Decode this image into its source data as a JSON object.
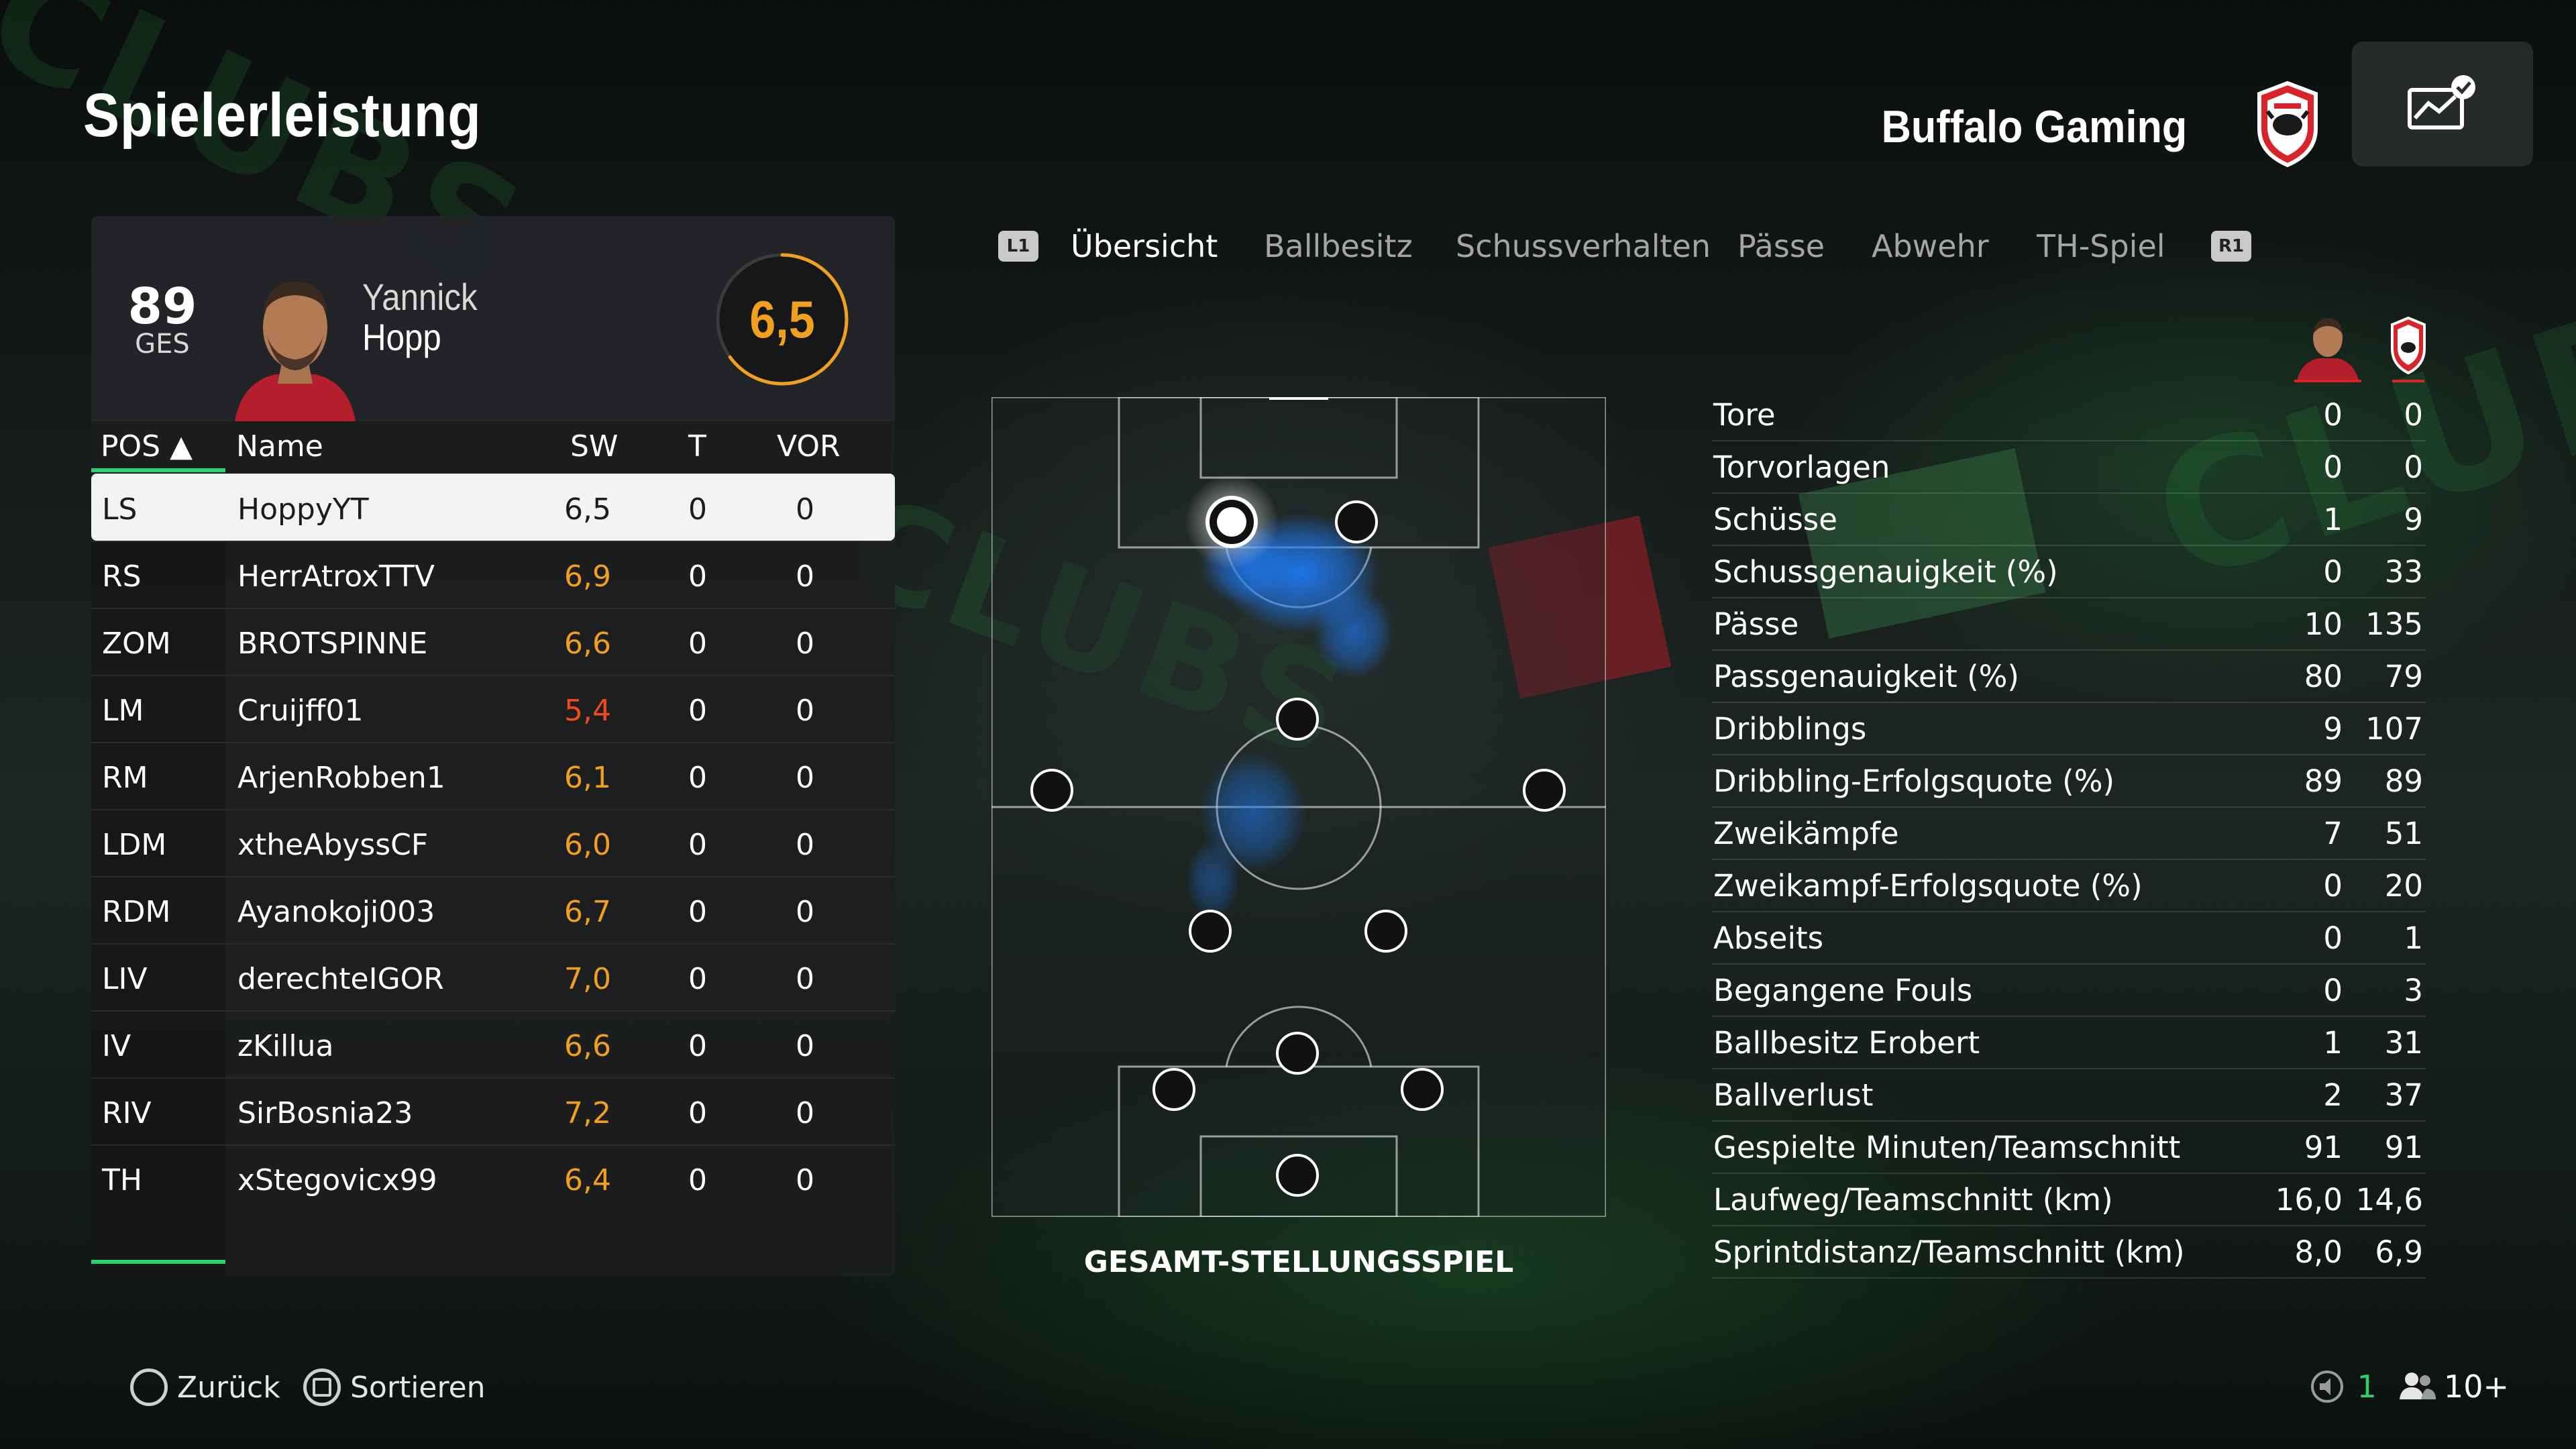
{
  "header": {
    "title": "Spielerleistung",
    "team_name": "Buffalo Gaming"
  },
  "player": {
    "overall": "89",
    "overall_label": "GES",
    "first_name": "Yannick",
    "last_name": "Hopp",
    "rating": "6,5"
  },
  "table": {
    "columns": {
      "pos": "POS ▲",
      "name": "Name",
      "sw": "SW",
      "t": "T",
      "vor": "VOR"
    },
    "rows": [
      {
        "pos": "LS",
        "name": "HoppyYT",
        "sw": "6,5",
        "t": "0",
        "vor": "0"
      },
      {
        "pos": "RS",
        "name": "HerrAtroxTTV",
        "sw": "6,9",
        "t": "0",
        "vor": "0"
      },
      {
        "pos": "ZOM",
        "name": "BROTSPINNE",
        "sw": "6,6",
        "t": "0",
        "vor": "0"
      },
      {
        "pos": "LM",
        "name": "Cruijff01",
        "sw": "5,4",
        "t": "0",
        "vor": "0"
      },
      {
        "pos": "RM",
        "name": "ArjenRobben1",
        "sw": "6,1",
        "t": "0",
        "vor": "0"
      },
      {
        "pos": "LDM",
        "name": "xtheAbyssCF",
        "sw": "6,0",
        "t": "0",
        "vor": "0"
      },
      {
        "pos": "RDM",
        "name": "Ayanokoji003",
        "sw": "6,7",
        "t": "0",
        "vor": "0"
      },
      {
        "pos": "LIV",
        "name": "derechteIGOR",
        "sw": "7,0",
        "t": "0",
        "vor": "0"
      },
      {
        "pos": "IV",
        "name": "zKillua",
        "sw": "6,6",
        "t": "0",
        "vor": "0"
      },
      {
        "pos": "RIV",
        "name": "SirBosnia23",
        "sw": "7,2",
        "t": "0",
        "vor": "0"
      },
      {
        "pos": "TH",
        "name": "xStegovicx99",
        "sw": "6,4",
        "t": "0",
        "vor": "0"
      }
    ],
    "selected_index": 0
  },
  "tabs": {
    "left_button": "L1",
    "right_button": "R1",
    "items": [
      "Übersicht",
      "Ballbesitz",
      "Schussverhalten",
      "Pässe",
      "Abwehr",
      "TH-Spiel"
    ],
    "active": 0
  },
  "pitch": {
    "caption": "GESAMT-STELLUNGSSPIEL"
  },
  "stats": [
    {
      "label": "Tore",
      "player": "0",
      "team": "0"
    },
    {
      "label": "Torvorlagen",
      "player": "0",
      "team": "0"
    },
    {
      "label": "Schüsse",
      "player": "1",
      "team": "9"
    },
    {
      "label": "Schussgenauigkeit (%)",
      "player": "0",
      "team": "33"
    },
    {
      "label": "Pässe",
      "player": "10",
      "team": "135"
    },
    {
      "label": "Passgenauigkeit (%)",
      "player": "80",
      "team": "79"
    },
    {
      "label": "Dribblings",
      "player": "9",
      "team": "107"
    },
    {
      "label": "Dribbling-Erfolgsquote (%)",
      "player": "89",
      "team": "89"
    },
    {
      "label": "Zweikämpfe",
      "player": "7",
      "team": "51"
    },
    {
      "label": "Zweikampf-Erfolgsquote (%)",
      "player": "0",
      "team": "20"
    },
    {
      "label": "Abseits",
      "player": "0",
      "team": "1"
    },
    {
      "label": "Begangene Fouls",
      "player": "0",
      "team": "3"
    },
    {
      "label": "Ballbesitz Erobert",
      "player": "1",
      "team": "31"
    },
    {
      "label": "Ballverlust",
      "player": "2",
      "team": "37"
    },
    {
      "label": "Gespielte Minuten/Teamschnitt",
      "player": "91",
      "team": "91"
    },
    {
      "label": "Laufweg/Teamschnitt (km)",
      "player": "16,0",
      "team": "14,6"
    },
    {
      "label": "Sprintdistanz/Teamschnitt (km)",
      "player": "8,0",
      "team": "6,9"
    }
  ],
  "footer": {
    "back_label": "Zurück",
    "sort_label": "Sortieren",
    "voice_count": "1",
    "party_count": "10+"
  },
  "colors": {
    "accent_green": "#2ecf6f",
    "rating_orange": "#f0a01e",
    "rating_red": "#f04a1e",
    "heatmap_blue": "#1e78f0"
  },
  "icons": {
    "stats_button": "chart-check-icon",
    "crest": "buffalo-crest-icon",
    "back": "circle-button-icon",
    "sort": "square-button-icon",
    "voice": "speaker-icon",
    "party": "people-icon"
  }
}
